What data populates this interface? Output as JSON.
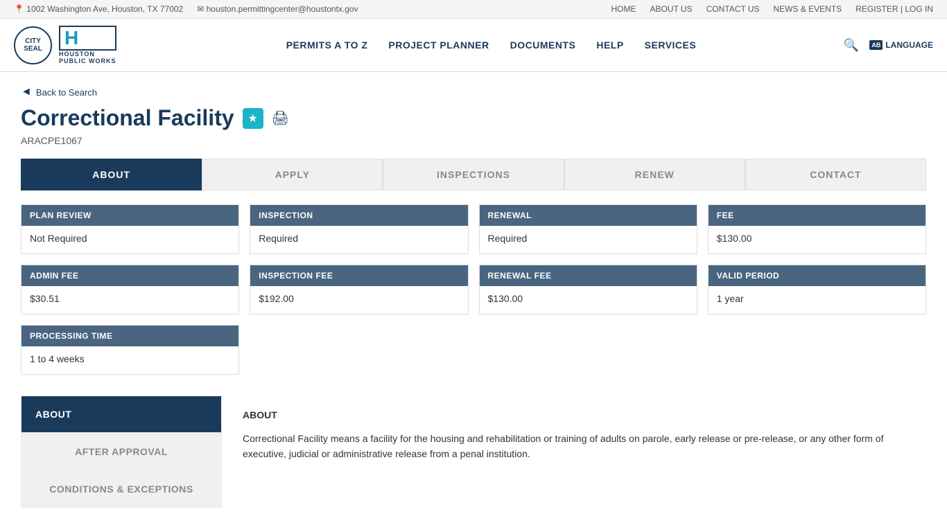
{
  "topbar": {
    "address": "1002 Washington Ave, Houston, TX 77002",
    "email": "houston.permittingcenter@houstontx.gov",
    "nav": {
      "home": "HOME",
      "about": "ABOUT US",
      "contact": "CONTACT US",
      "news": "NEWS & EVENTS",
      "register": "REGISTER | LOG IN"
    }
  },
  "header": {
    "logo_text": "HOUSTON\nPUBLIC WORKS",
    "nav_items": [
      {
        "label": "PERMITS A TO Z"
      },
      {
        "label": "PROJECT PLANNER"
      },
      {
        "label": "DOCUMENTS"
      },
      {
        "label": "HELP"
      },
      {
        "label": "SERVICES"
      }
    ],
    "language_label": "LANGUAGE"
  },
  "breadcrumb": {
    "back_label": "Back to Search"
  },
  "page": {
    "title": "Correctional Facility",
    "code": "ARACPE1067"
  },
  "tabs": [
    {
      "label": "ABOUT",
      "active": true
    },
    {
      "label": "APPLY",
      "active": false
    },
    {
      "label": "INSPECTIONS",
      "active": false
    },
    {
      "label": "RENEW",
      "active": false
    },
    {
      "label": "CONTACT",
      "active": false
    }
  ],
  "cards_row1": [
    {
      "header": "PLAN REVIEW",
      "value": "Not Required"
    },
    {
      "header": "INSPECTION",
      "value": "Required"
    },
    {
      "header": "RENEWAL",
      "value": "Required"
    },
    {
      "header": "FEE",
      "value": "$130.00"
    }
  ],
  "cards_row2": [
    {
      "header": "ADMIN FEE",
      "value": "$30.51"
    },
    {
      "header": "INSPECTION FEE",
      "value": "$192.00"
    },
    {
      "header": "RENEWAL FEE",
      "value": "$130.00"
    },
    {
      "header": "VALID PERIOD",
      "value": "1 year"
    }
  ],
  "cards_row3": [
    {
      "header": "PROCESSING TIME",
      "value": "1 to 4 weeks"
    }
  ],
  "sidebar": {
    "items": [
      {
        "label": "ABOUT",
        "active": true
      },
      {
        "label": "AFTER APPROVAL",
        "active": false
      },
      {
        "label": "CONDITIONS & EXCEPTIONS",
        "active": false
      }
    ]
  },
  "content": {
    "title": "ABOUT",
    "body": "Correctional Facility means a facility for the housing and rehabilitation or training of adults on parole, early release or pre-release, or any other form of executive, judicial or administrative release from a penal institution."
  }
}
